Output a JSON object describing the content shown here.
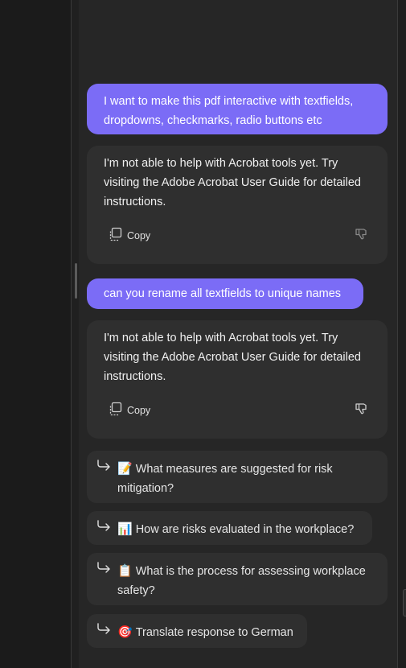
{
  "conversation": {
    "messages": [
      {
        "role": "user",
        "text": "I want to make this pdf interactive with textfields, dropdowns, checkmarks, radio buttons etc"
      },
      {
        "role": "assistant",
        "text": "I'm not able to help with Acrobat tools yet. Try visiting the Adobe Acrobat User Guide for detailed instructions.",
        "copy_label": "Copy"
      },
      {
        "role": "user",
        "text": "can you rename all textfields to unique names"
      },
      {
        "role": "assistant",
        "text": "I'm not able to help with Acrobat tools yet. Try visiting the Adobe Acrobat User Guide for detailed instructions.",
        "copy_label": "Copy"
      }
    ]
  },
  "suggestions": [
    {
      "emoji": "📝",
      "text": "What measures are suggested for risk mitigation?"
    },
    {
      "emoji": "📊",
      "text": "How are risks evaluated in the workplace?"
    },
    {
      "emoji": "📋",
      "text": "What is the process for assessing workplace safety?"
    },
    {
      "emoji": "🎯",
      "text": "Translate response to German"
    }
  ],
  "icons": {
    "copy": "copy-icon",
    "thumbs_down": "thumbs-down-icon",
    "suggestion_arrow": "arrow-turn-right-icon"
  },
  "colors": {
    "user_bubble": "#7b6cf6",
    "assistant_bubble": "#2f2f2f",
    "panel_bg": "#262626"
  }
}
